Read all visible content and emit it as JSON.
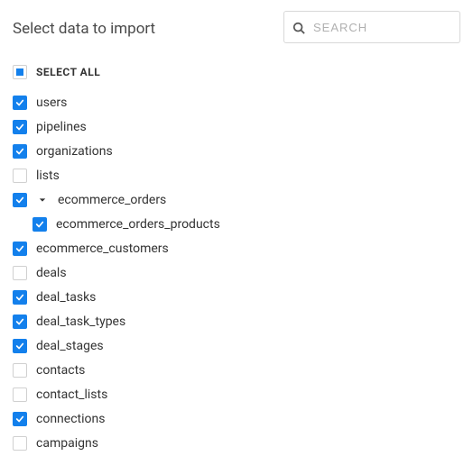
{
  "header": {
    "title": "Select data to import",
    "search_placeholder": "SEARCH"
  },
  "select_all": {
    "label": "SELECT ALL",
    "state": "indeterminate"
  },
  "colors": {
    "accent": "#1380ec"
  },
  "items": [
    {
      "id": "users",
      "label": "users",
      "checked": true,
      "level": 1,
      "expandable": false
    },
    {
      "id": "pipelines",
      "label": "pipelines",
      "checked": true,
      "level": 1,
      "expandable": false
    },
    {
      "id": "organizations",
      "label": "organizations",
      "checked": true,
      "level": 1,
      "expandable": false
    },
    {
      "id": "lists",
      "label": "lists",
      "checked": false,
      "level": 1,
      "expandable": false
    },
    {
      "id": "ecommerce_orders",
      "label": "ecommerce_orders",
      "checked": true,
      "level": 1,
      "expandable": true,
      "expanded": true
    },
    {
      "id": "ecommerce_orders_products",
      "label": "ecommerce_orders_products",
      "checked": true,
      "level": 2,
      "expandable": false
    },
    {
      "id": "ecommerce_customers",
      "label": "ecommerce_customers",
      "checked": true,
      "level": 1,
      "expandable": false
    },
    {
      "id": "deals",
      "label": "deals",
      "checked": false,
      "level": 1,
      "expandable": false
    },
    {
      "id": "deal_tasks",
      "label": "deal_tasks",
      "checked": true,
      "level": 1,
      "expandable": false
    },
    {
      "id": "deal_task_types",
      "label": "deal_task_types",
      "checked": true,
      "level": 1,
      "expandable": false
    },
    {
      "id": "deal_stages",
      "label": "deal_stages",
      "checked": true,
      "level": 1,
      "expandable": false
    },
    {
      "id": "contacts",
      "label": "contacts",
      "checked": false,
      "level": 1,
      "expandable": false
    },
    {
      "id": "contact_lists",
      "label": "contact_lists",
      "checked": false,
      "level": 1,
      "expandable": false
    },
    {
      "id": "connections",
      "label": "connections",
      "checked": true,
      "level": 1,
      "expandable": false
    },
    {
      "id": "campaigns",
      "label": "campaigns",
      "checked": false,
      "level": 1,
      "expandable": false
    }
  ]
}
